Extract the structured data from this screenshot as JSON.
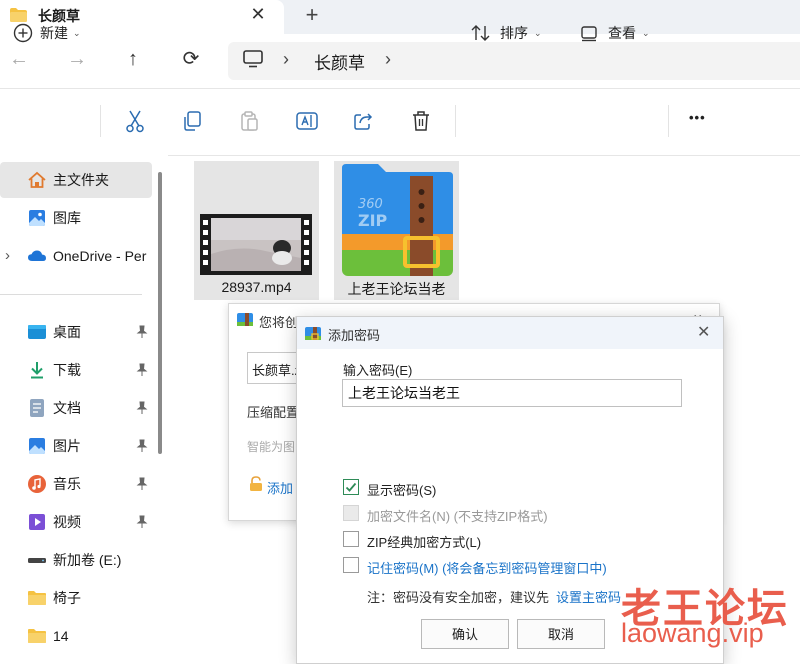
{
  "tab": {
    "title": "长颜草",
    "close": "✕",
    "new_tab": "+"
  },
  "nav": {
    "back": "←",
    "forward": "→",
    "up": "↑",
    "refresh": "⟳"
  },
  "address": {
    "separator": "›",
    "crumb": "长颜草",
    "crumb_sep": "›"
  },
  "toolbar": {
    "new_label": "新建",
    "sort_label": "排序",
    "view_label": "查看",
    "more": "•••"
  },
  "sidebar": {
    "items": [
      {
        "label": "主文件夹",
        "icon": "home-icon"
      },
      {
        "label": "图库",
        "icon": "gallery-icon"
      },
      {
        "label": "OneDrive - Per",
        "icon": "cloud-icon",
        "expand": "›"
      },
      {
        "label": "桌面",
        "icon": "desktop-icon",
        "pinned": true
      },
      {
        "label": "下载",
        "icon": "download-icon",
        "pinned": true
      },
      {
        "label": "文档",
        "icon": "document-icon",
        "pinned": true
      },
      {
        "label": "图片",
        "icon": "picture-icon",
        "pinned": true
      },
      {
        "label": "音乐",
        "icon": "music-icon",
        "pinned": true
      },
      {
        "label": "视频",
        "icon": "video-icon",
        "pinned": true
      },
      {
        "label": "新加卷 (E:)",
        "icon": "drive-icon"
      },
      {
        "label": "椅子",
        "icon": "folder-icon"
      },
      {
        "label": "14",
        "icon": "folder-icon"
      }
    ]
  },
  "files": [
    {
      "name": "28937.mp4",
      "type": "video"
    },
    {
      "name": "上老王论坛当老王.zip",
      "type": "zip",
      "visible_label": "上老王论坛当老",
      "zip_badge_top": "360",
      "zip_badge_bottom": "ZIP"
    }
  ],
  "back_dialog": {
    "title": "您将创",
    "path": "长颜草.z",
    "compress_config": "压缩配置",
    "smart_hint": "智能为图",
    "add_password": "添加"
  },
  "password_dialog": {
    "title": "添加密码",
    "close": "✕",
    "input_label": "输入密码(E)",
    "input_value": "上老王论坛当老王",
    "options": [
      {
        "label": "显示密码(S)",
        "checked": true,
        "disabled": false
      },
      {
        "label": "加密文件名(N) (不支持ZIP格式)",
        "checked": false,
        "disabled": true
      },
      {
        "label": "ZIP经典加密方式(L)",
        "checked": false,
        "disabled": false
      },
      {
        "label": "记住密码(M) (将会备忘到密码管理窗口中)",
        "checked": false,
        "disabled": false
      }
    ],
    "note_prefix": "注：密码没有安全加密，建议先",
    "note_link": "设置主密码",
    "ok": "确认",
    "cancel": "取消"
  },
  "watermark": {
    "line1": "老王论坛",
    "line2": "laowang.vip"
  },
  "colors": {
    "accent": "#0067c0",
    "link": "#1a73c8",
    "watermark": "#e8513e",
    "folder": "#f5c242"
  }
}
